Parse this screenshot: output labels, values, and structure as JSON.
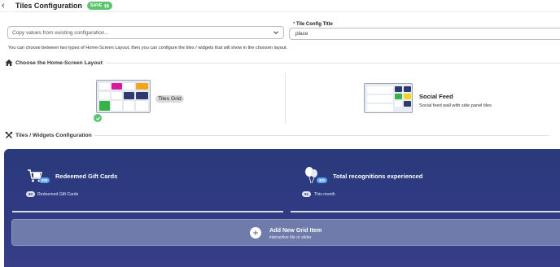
{
  "header": {
    "title": "Tiles Configuration",
    "save_label": "SAVE"
  },
  "copy_select": {
    "value": "Copy values from existing configuration..."
  },
  "tile_title": {
    "required_mark": "*",
    "label": "Tile Config Title",
    "value": "place"
  },
  "help_text": "You can choose between two types of Home-Screen Layout, then you can configure the tiles / widgets that will show in the choosen layout.",
  "layout_section": {
    "heading": "Choose the Home-Screen Layout",
    "options": [
      {
        "label": "Tiles Grid",
        "selected": true
      },
      {
        "label": "Social Feed",
        "description": "Social feed wall with side panel tiles",
        "selected": false
      }
    ]
  },
  "tiles_section": {
    "heading": "Tiles / Widgets Configuration",
    "widgets": [
      {
        "title": "Redeemed Gift Cards",
        "icon": "gift-cart-icon",
        "icon_badge": "205",
        "stat_value": "83",
        "stat_label": "Redeemed Gift Cards"
      },
      {
        "title": "Total recognitions experienced",
        "icon": "balloons-icon",
        "icon_badge": "401",
        "stat_value": "91",
        "stat_label": "This month"
      }
    ],
    "add_item": {
      "title": "Add New Grid Item",
      "subtitle": "interactive tile or slider"
    }
  },
  "colors": {
    "accent_green": "#5cc36f",
    "panel_navy": "#2f3a82",
    "badge_blue": "#5aa3f0"
  }
}
